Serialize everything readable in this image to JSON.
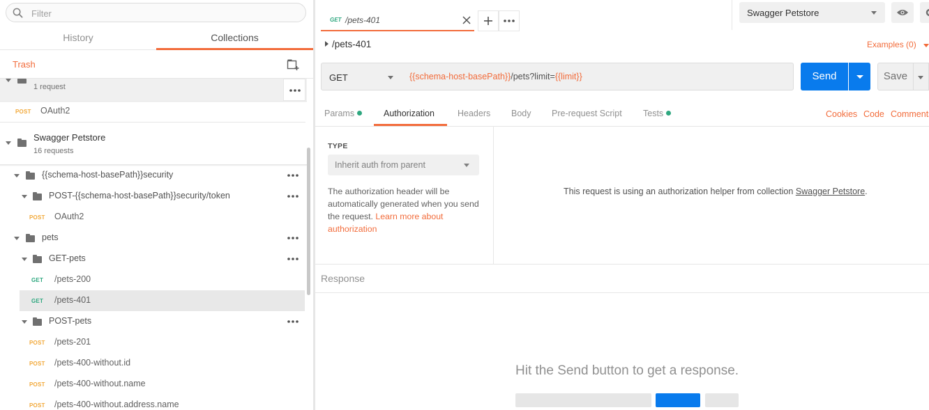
{
  "sidebar": {
    "filter_placeholder": "Filter",
    "tabs": {
      "history": "History",
      "collections": "Collections"
    },
    "trash_label": "Trash",
    "collections": [
      {
        "name": "",
        "count": "1 request"
      },
      {
        "name": "Swagger Petstore",
        "count": "16 requests"
      }
    ],
    "first_collection_items": [
      {
        "method": "POST",
        "name": "OAuth2"
      }
    ],
    "tree": {
      "security_folder": "{{schema-host-basePath}}security",
      "token_folder": "POST-{{schema-host-basePath}}security/token",
      "oauth_item": {
        "method": "POST",
        "name": "OAuth2"
      },
      "pets_folder": "pets",
      "get_pets_folder": "GET-pets",
      "get_items": [
        {
          "method": "GET",
          "name": "/pets-200"
        },
        {
          "method": "GET",
          "name": "/pets-401"
        }
      ],
      "post_pets_folder": "POST-pets",
      "post_items": [
        {
          "method": "POST",
          "name": "/pets-201"
        },
        {
          "method": "POST",
          "name": "/pets-400-without.id"
        },
        {
          "method": "POST",
          "name": "/pets-400-without.name"
        },
        {
          "method": "POST",
          "name": "/pets-400-without.address.name"
        }
      ]
    }
  },
  "request_tab": {
    "method": "GET",
    "title": "/pets-401"
  },
  "environment": {
    "selected": "Swagger Petstore"
  },
  "request": {
    "title": "/pets-401",
    "examples": "Examples (0)",
    "method": "GET",
    "url_var1": "{{schema-host-basePath}}",
    "url_mid": "/pets?limit=",
    "url_var2": "{{limit}}",
    "send_label": "Send",
    "save_label": "Save"
  },
  "request_tabs": {
    "params": "Params",
    "authorization": "Authorization",
    "headers": "Headers",
    "body": "Body",
    "prerequest": "Pre-request Script",
    "tests": "Tests",
    "cookies": "Cookies",
    "code": "Code",
    "comments": "Comments"
  },
  "auth": {
    "type_label": "TYPE",
    "type_value": "Inherit auth from parent",
    "desc": "The authorization header will be automatically generated when you send the request. ",
    "learn_more": "Learn more about authorization",
    "helper_msg": "This request is using an authorization helper from collection ",
    "helper_collection": "Swagger Petstore",
    "helper_end": "."
  },
  "response": {
    "label": "Response",
    "empty_msg": "Hit the Send button to get a response."
  },
  "colors": {
    "accent": "#f26b3a",
    "primary": "#097bed",
    "get": "#2ea77f",
    "post": "#f2a93a"
  }
}
